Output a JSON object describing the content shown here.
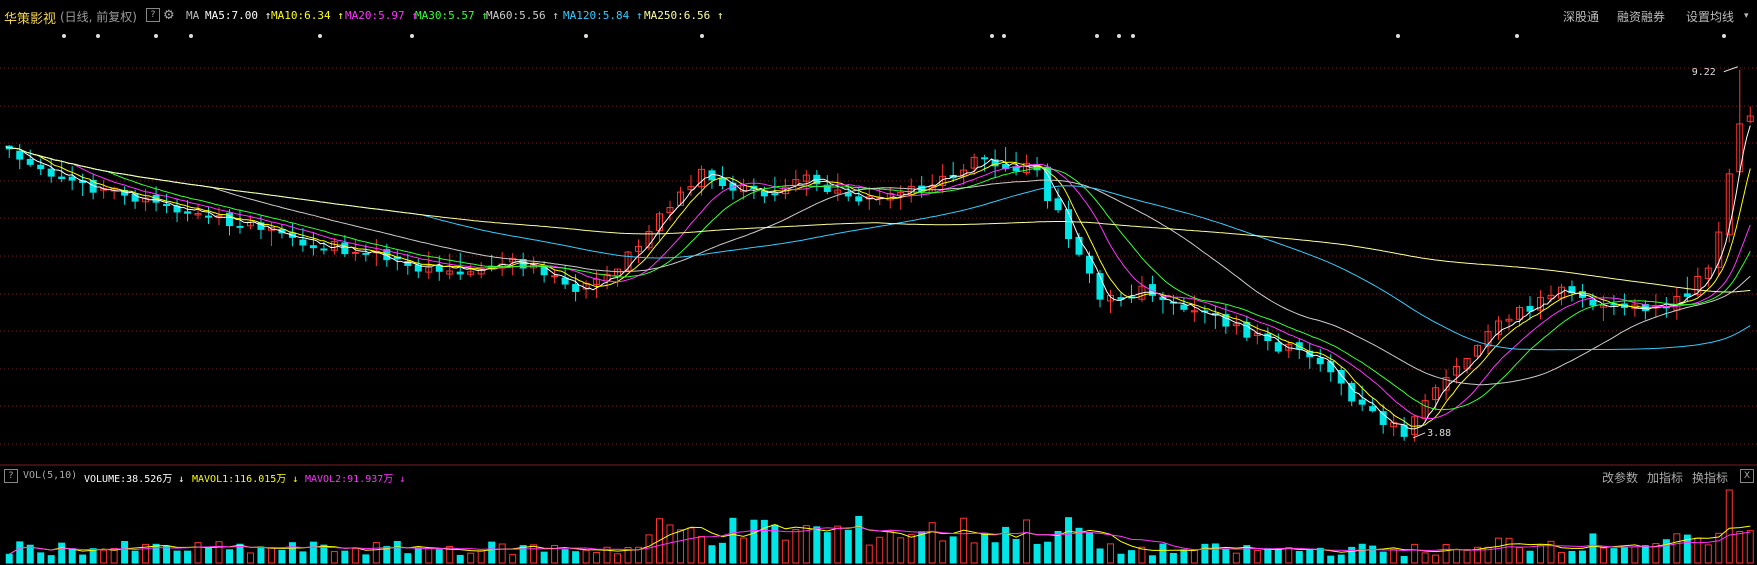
{
  "header": {
    "stock_name": "华策影视",
    "period": "(日线, 前复权)",
    "help_glyph": "?",
    "ma_group": "MA",
    "ma_items": [
      {
        "label": "MA5:7.00",
        "arrow": "↑",
        "color": "#ffffff"
      },
      {
        "label": "MA10:6.34",
        "arrow": "↑",
        "color": "#ffff00"
      },
      {
        "label": "MA20:5.97",
        "arrow": "↑",
        "color": "#ff33ff"
      },
      {
        "label": "MA30:5.57",
        "arrow": "↑",
        "color": "#33ff33"
      },
      {
        "label": "MA60:5.56",
        "arrow": "↑",
        "color": "#cccccc"
      },
      {
        "label": "MA120:5.84",
        "arrow": "↑",
        "color": "#33ccff"
      },
      {
        "label": "MA250:6.56",
        "arrow": "↑",
        "color": "#ffff99"
      }
    ],
    "right_links": [
      "深股通",
      "融资融券",
      "设置均线"
    ]
  },
  "volume_header": {
    "help_glyph": "?",
    "vol_params": "VOL(5,10)",
    "items": [
      {
        "label": "VOLUME:38.526万",
        "arrow": "↓",
        "color": "#ffffff"
      },
      {
        "label": "MAVOL1:116.015万",
        "arrow": "↓",
        "color": "#ffff00"
      },
      {
        "label": "MAVOL2:91.937万",
        "arrow": "↓",
        "color": "#ff33ff"
      }
    ],
    "links": [
      "改参数",
      "加指标",
      "换指标"
    ],
    "close_glyph": "X"
  },
  "chart_data": {
    "type": "candlestick",
    "high_label": "9.22",
    "low_label": "3.88",
    "price_range": [
      3.6,
      9.8
    ],
    "colors": {
      "up": "#ff3333",
      "down": "#00e5e5",
      "background": "#000000"
    }
  }
}
